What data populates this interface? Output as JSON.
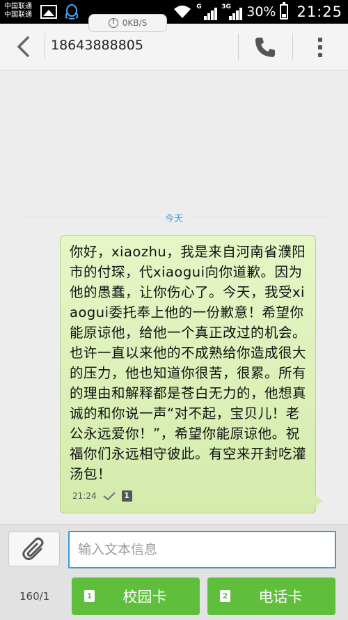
{
  "status_bar": {
    "carrier_1": "中国联通",
    "carrier_2": "中国联通",
    "network_1": "G",
    "network_2": "3G",
    "battery_percent": "30%",
    "battery_level": 0.3,
    "time": "21:25"
  },
  "speed_indicator": {
    "text": "0KB/S"
  },
  "toolbar": {
    "contact_number": "18643888805"
  },
  "conversation": {
    "date_label": "今天",
    "message": {
      "text": "你好，xiaozhu，我是来自河南省濮阳市的付琛，代xiaogui向你道歉。因为他的愚蠢，让你伤心了。今天，我受xiaogui委托奉上他的一份歉意！希望你能原谅他，给他一个真正改过的机会。也许一直以来他的不成熟给你造成很大的压力，他也知道你很苦，很累。所有的理由和解释都是苍白无力的，他想真诚的和你说一声“对不起，宝贝儿！老公永远爱你！”，希望你能原谅他。祝福你们永远相守彼此。有空来开封吃灌汤包！",
      "time": "21:24",
      "sim_badge": "1"
    }
  },
  "composer": {
    "placeholder": "输入文本信息",
    "char_count": "160/1",
    "send_sim1": {
      "badge": "1",
      "label": "校园卡"
    },
    "send_sim2": {
      "badge": "2",
      "label": "电话卡"
    }
  },
  "colors": {
    "accent": "#3a9ad9",
    "send_button": "#5fbf3d",
    "bubble": "#dcefb8"
  }
}
